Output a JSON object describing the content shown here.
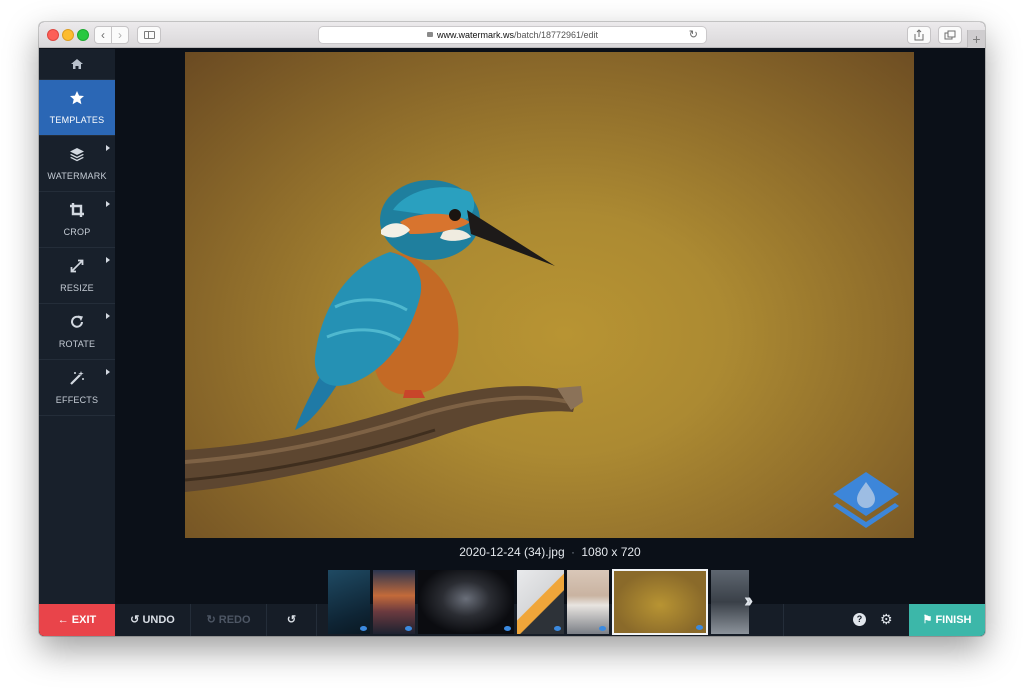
{
  "browser": {
    "url_domain": "www.watermark.ws",
    "url_path": "/batch/18772961/edit",
    "nav_back": "‹",
    "nav_forward": "›",
    "new_tab": "+"
  },
  "sidebar": {
    "items": [
      {
        "label": "TEMPLATES",
        "icon": "star-icon",
        "active": true
      },
      {
        "label": "WATERMARK",
        "icon": "layers-icon"
      },
      {
        "label": "CROP",
        "icon": "crop-icon"
      },
      {
        "label": "RESIZE",
        "icon": "resize-icon"
      },
      {
        "label": "ROTATE",
        "icon": "rotate-icon"
      },
      {
        "label": "EFFECTS",
        "icon": "magic-wand-icon"
      }
    ]
  },
  "image": {
    "filename": "2020-12-24 (34).jpg",
    "separator": "·",
    "dimensions": "1080 x 720"
  },
  "toolbar": {
    "exit": "EXIT",
    "undo": "UNDO",
    "redo": "REDO",
    "finish": "FINISH",
    "help": "?"
  },
  "colors": {
    "accent": "#2b67b5",
    "exit": "#e9444a",
    "finish": "#3cb7a9",
    "watermark_logo": "#3d86d9"
  }
}
